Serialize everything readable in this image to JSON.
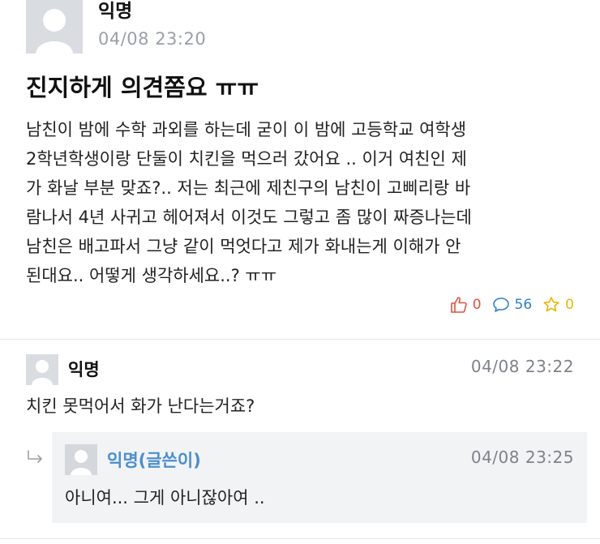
{
  "post": {
    "author": "익명",
    "time": "04/08 23:20",
    "title": "진지하게 의견쫌요 ㅠㅠ",
    "body_lines": [
      "남친이 밤에 수학 과외를 하는데 굳이 이 밤에 고등학교 여학생",
      "2학년학생이랑 단둘이 치킨을 먹으러 갔어요 .. 이거 여친인 제",
      "가 화날 부분 맞죠?.. 저는 최근에 제친구의 남친이 고삐리랑 바",
      "람나서 4년 사귀고 헤어져서 이것도 그렇고 좀 많이 짜증나는데",
      "남친은 배고파서 그냥 같이 먹엇다고 제가 화내는게 이해가 안",
      "된대요.. 어떻게 생각하세요..? ㅠㅠ"
    ],
    "likes": "0",
    "comments": "56",
    "scraps": "0"
  },
  "comments": [
    {
      "author": "익명",
      "time": "04/08 23:22",
      "text": "치킨 못먹어서 화가 난다는거죠?"
    }
  ],
  "reply": {
    "author": "익명(글쓴이)",
    "time": "04/08 23:25",
    "text": "아니여... 그게 아니잖아여 .."
  },
  "icons": {
    "like": "thumbs-up-icon",
    "comment": "speech-bubble-icon",
    "scrap": "star-icon",
    "reply": "reply-arrow-icon",
    "avatar": "default-avatar-icon"
  },
  "colors": {
    "like": "#e0533f",
    "comment": "#2f7fc9",
    "scrap": "#e9b500",
    "reply_author": "#4b8ed1",
    "avatar_bg": "#d9dde2"
  }
}
